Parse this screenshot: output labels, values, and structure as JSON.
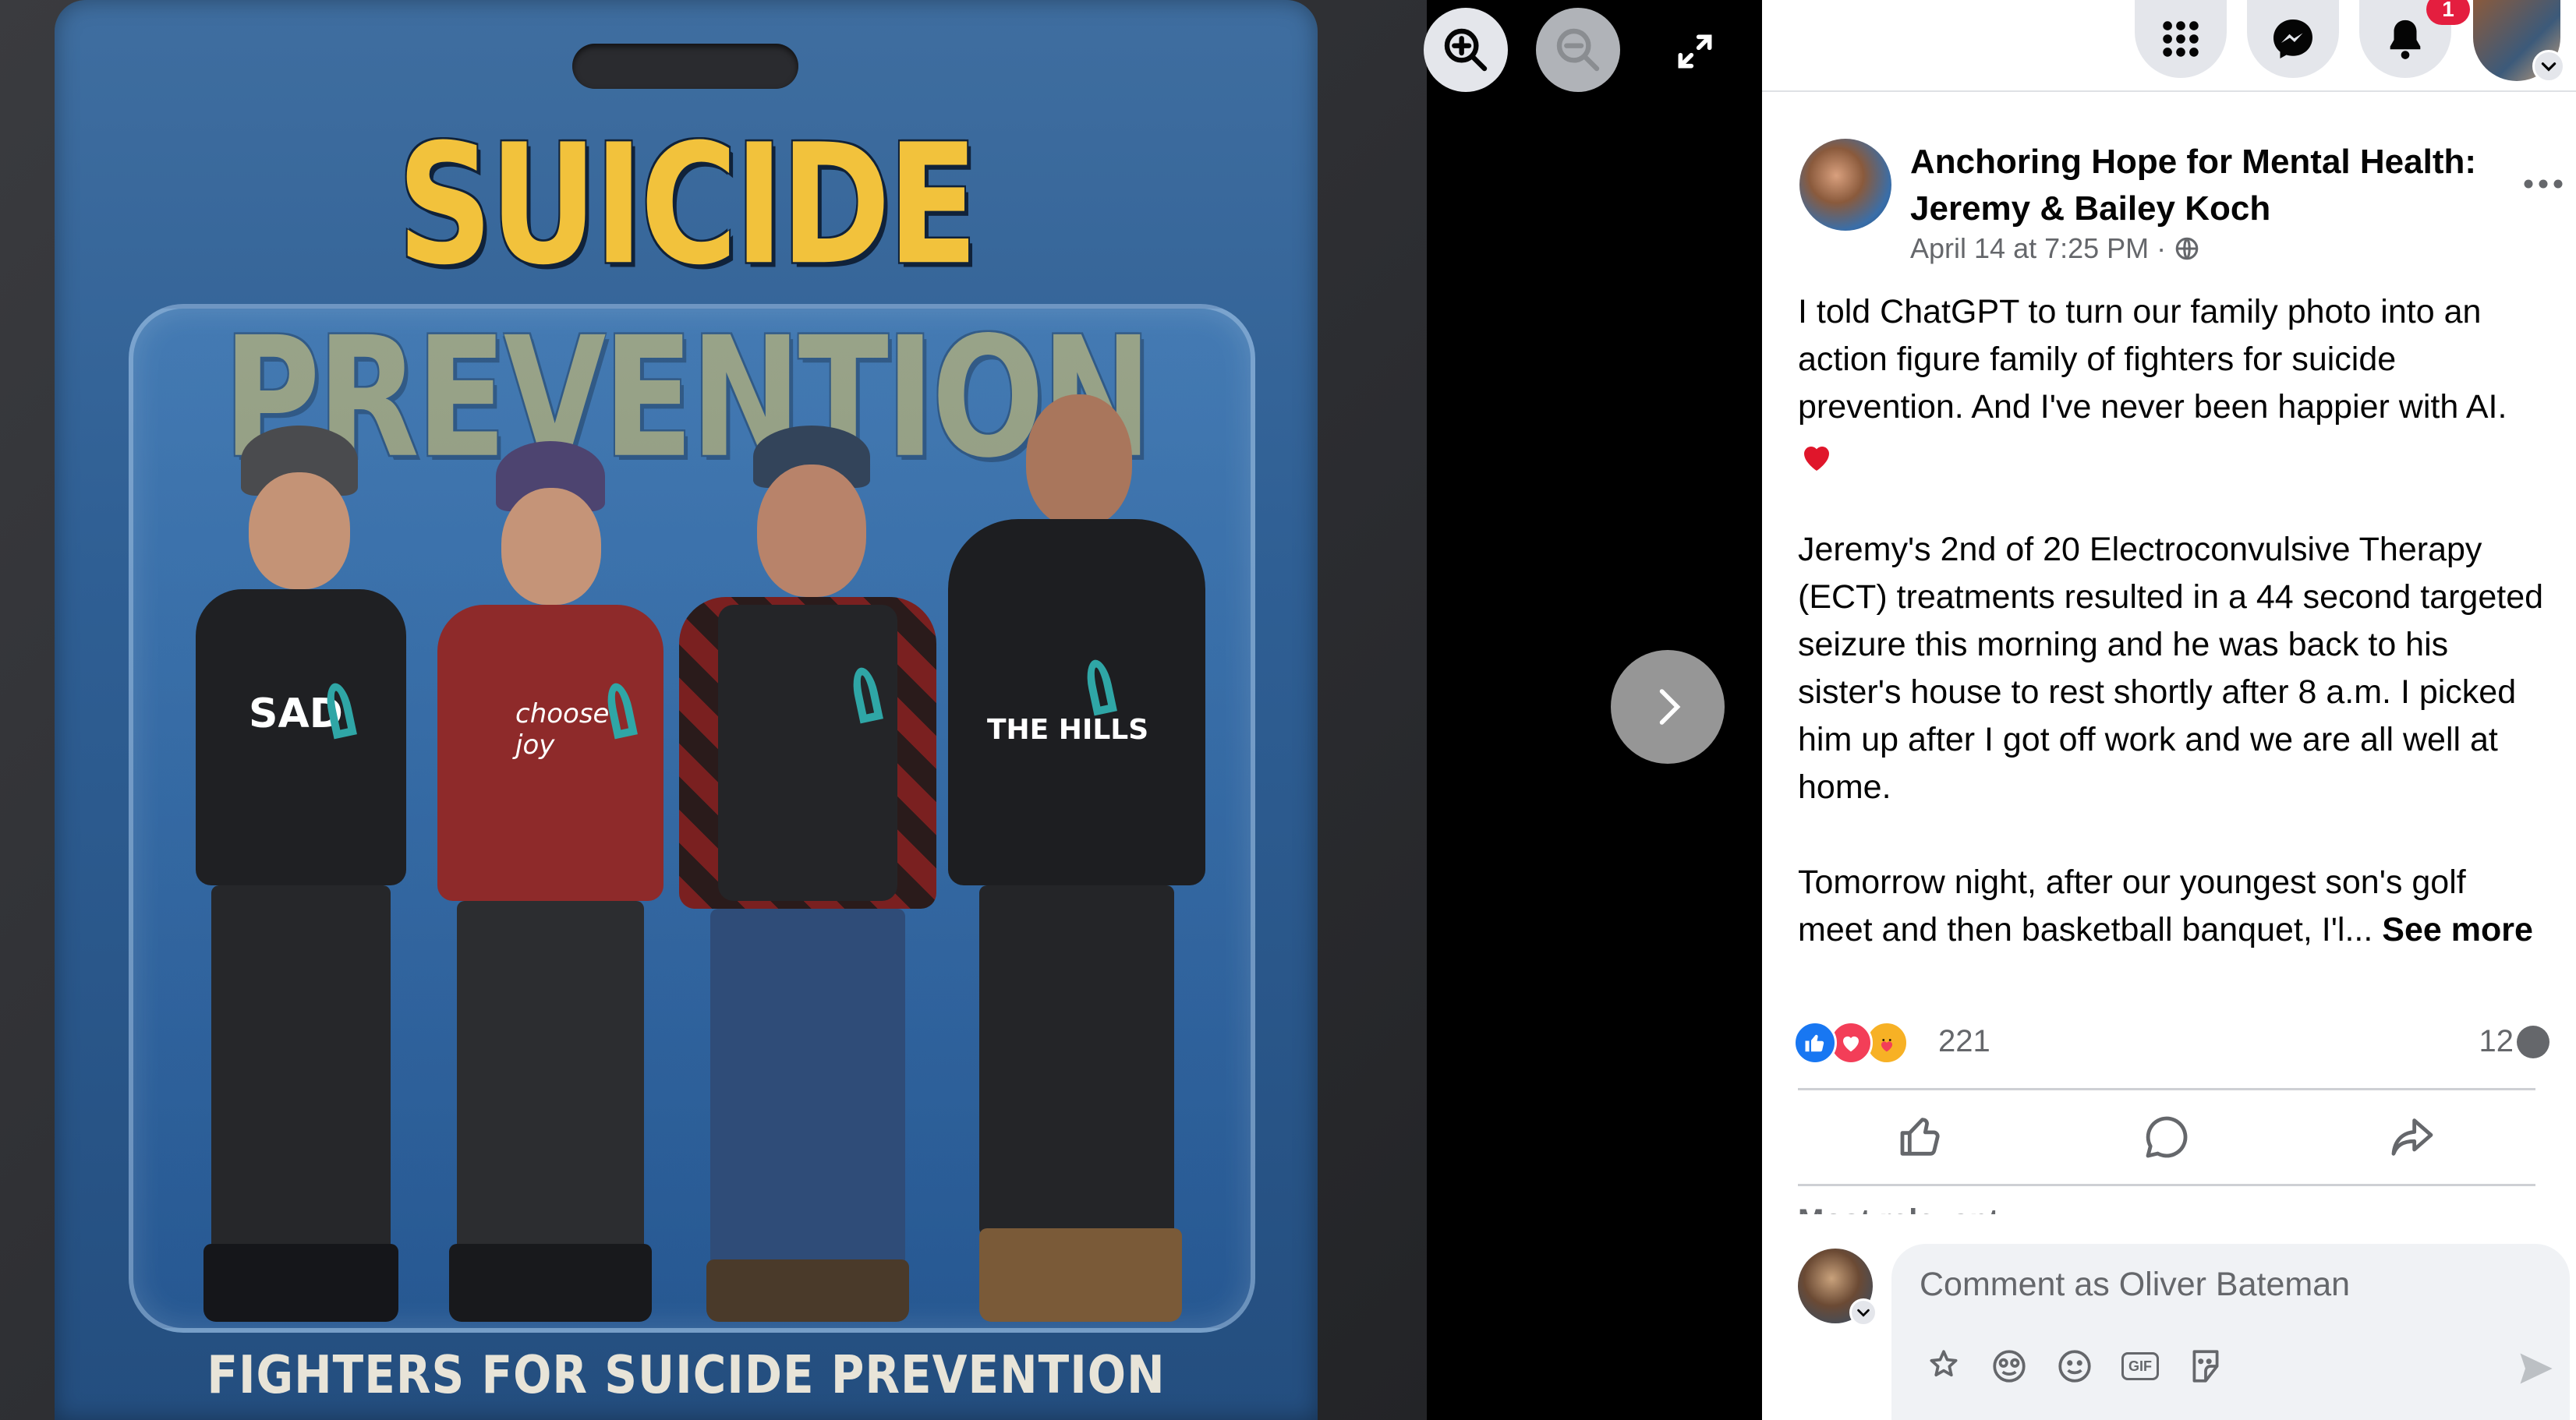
{
  "photo": {
    "card_title": "SUICIDE PREVENTION",
    "card_subtitle": "FIGHTERS FOR SUICIDE PREVENTION",
    "figures": [
      {
        "shirt_text": "SAD"
      },
      {
        "shirt_text": "choose joy"
      },
      {
        "shirt_text": ""
      },
      {
        "shirt_text": "THE HILLS"
      }
    ]
  },
  "viewer_controls": {
    "zoom_in_icon": "zoom-in-icon",
    "zoom_out_icon": "zoom-out-icon",
    "fullscreen_icon": "fullscreen-icon",
    "next_icon": "chevron-right-icon"
  },
  "topbar": {
    "notifications_badge": "1"
  },
  "post": {
    "page_name": "Anchoring Hope for Mental Health: Jeremy & Bailey Koch",
    "timestamp": "April 14 at 7:25 PM",
    "separator": "·",
    "paragraph_1": "I told ChatGPT to turn our family photo into an action figure family of fighters for suicide prevention. And I've never been happier with AI.",
    "paragraph_1_emoji": "❤️",
    "paragraph_2": "Jeremy's 2nd of 20 Electroconvulsive Therapy (ECT) treatments resulted in a 44 second targeted seizure this morning and he was back to his sister's house to rest shortly after 8 a.m. I picked him up after I got off work and we are all well at home.",
    "paragraph_3": "Tomorrow night, after our youngest son's golf meet and then basketball banquet, I'l...",
    "see_more": "See more"
  },
  "engagement": {
    "reaction_count": "221",
    "comment_count": "12",
    "reactions": [
      "like",
      "love",
      "care"
    ]
  },
  "comments": {
    "sort_label": "Most relevant"
  },
  "composer": {
    "placeholder": "Comment as Oliver Bateman",
    "gif_label": "GIF"
  },
  "colors": {
    "fb_blue": "#1877f2",
    "love_red": "#f33e58",
    "care_yellow": "#f7b125",
    "ribbon_teal": "#2fa6a6",
    "title_yellow": "#f2c23c"
  }
}
